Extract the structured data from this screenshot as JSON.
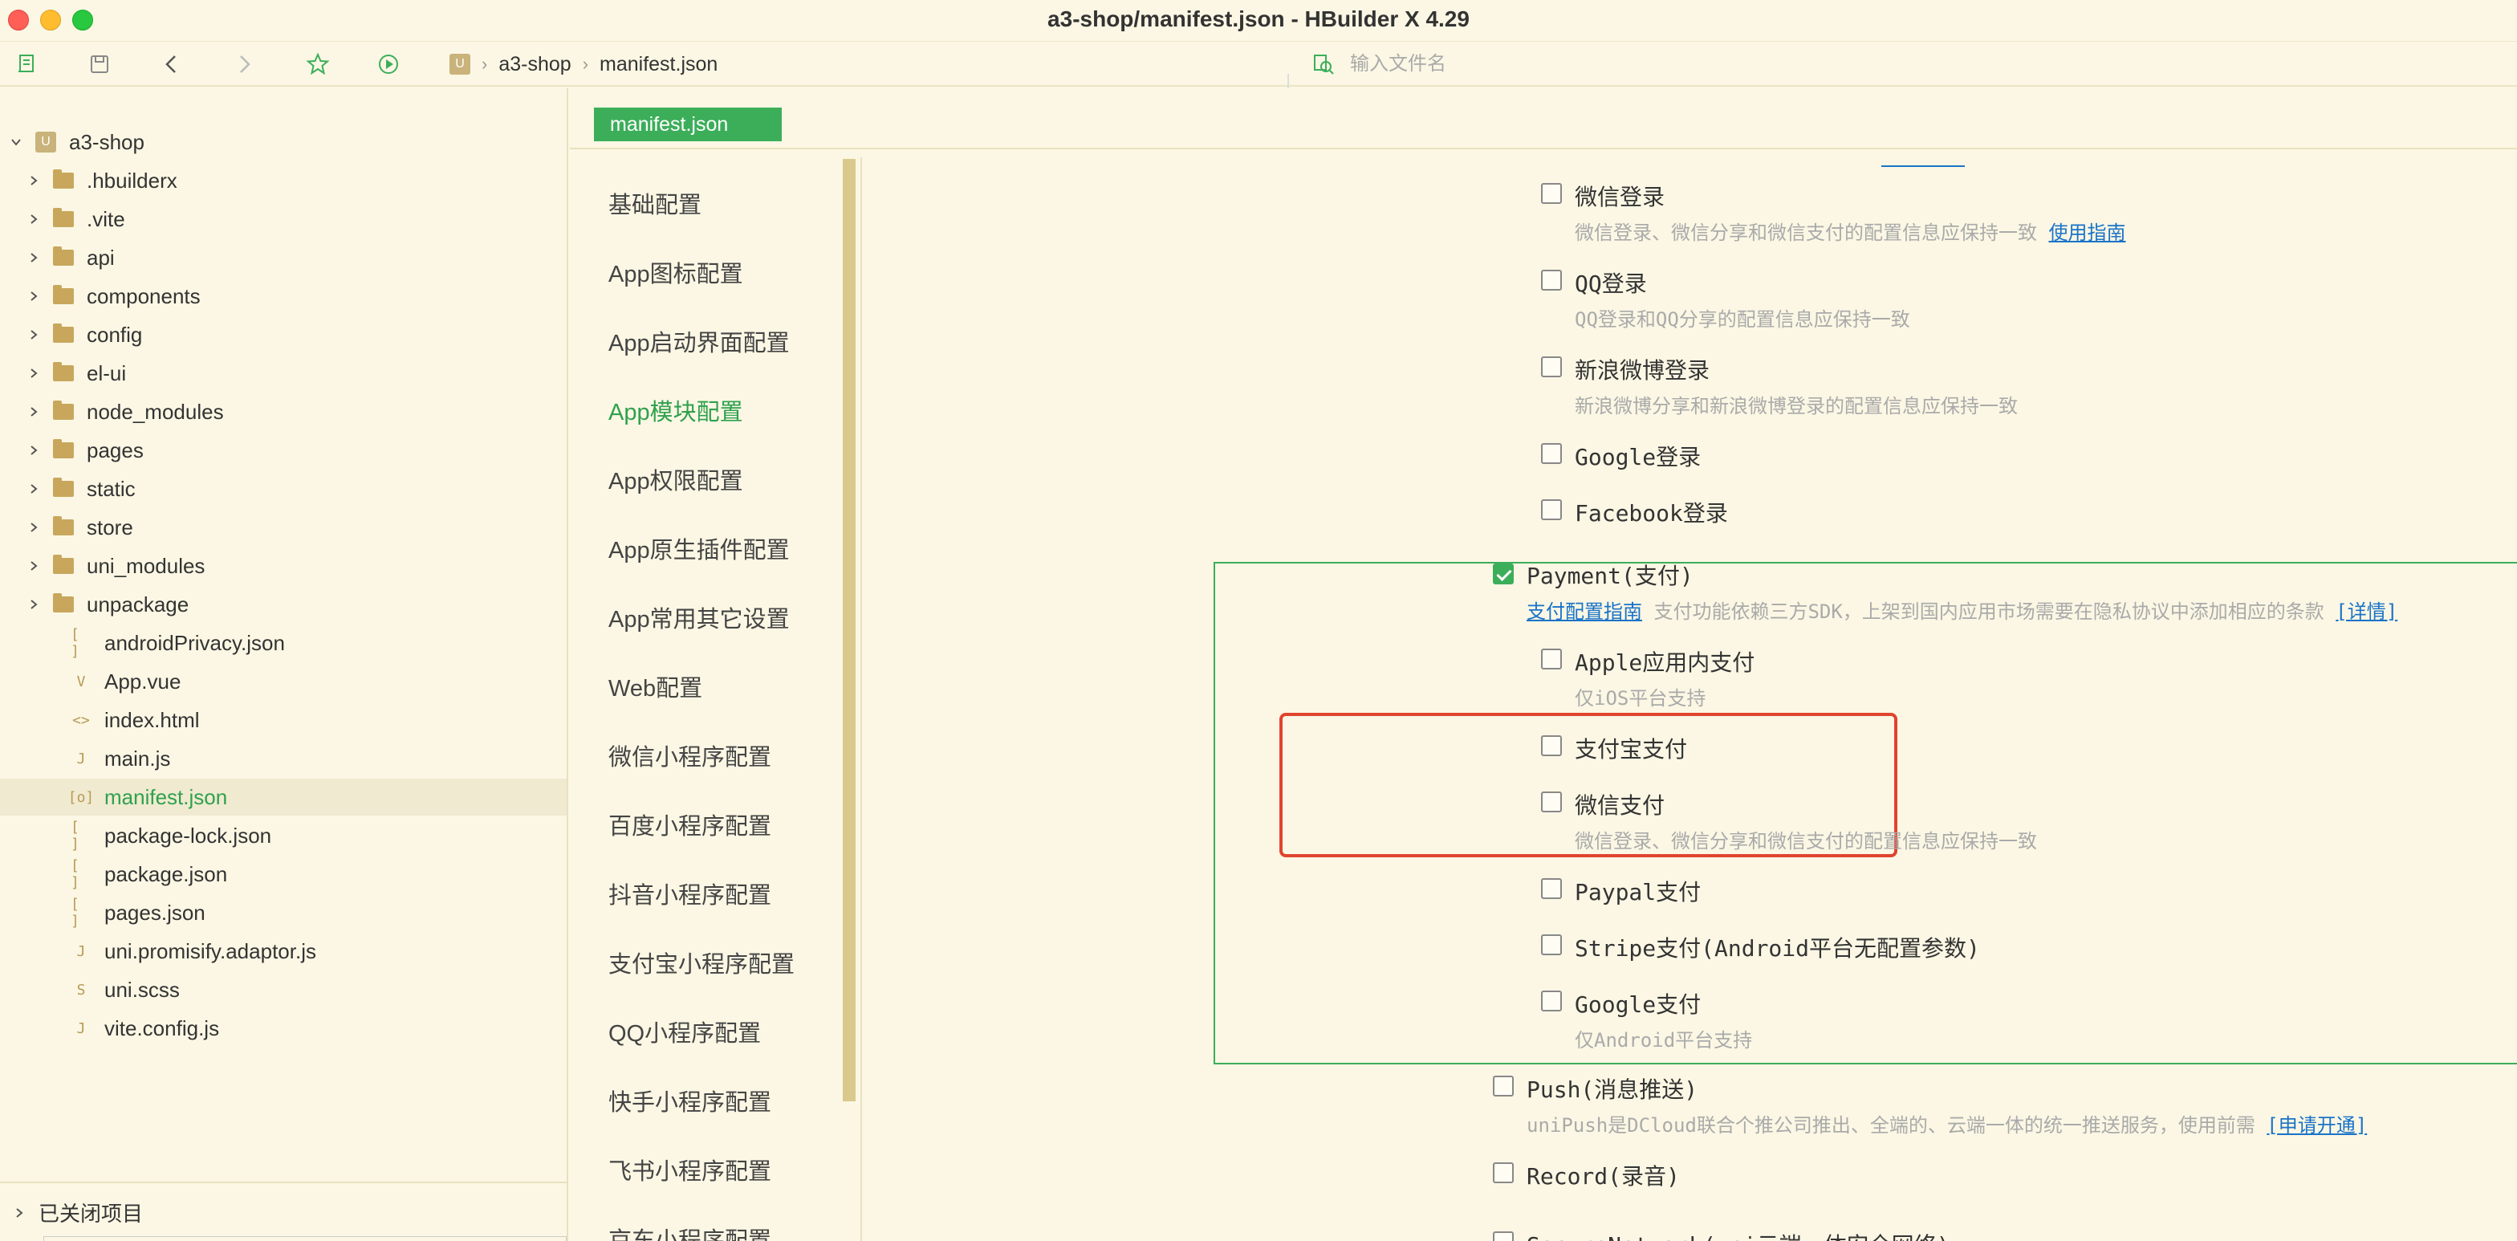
{
  "window": {
    "title": "a3-shop/manifest.json - HBuilder X 4.29"
  },
  "toolbar": {
    "breadcrumb": [
      "a3-shop",
      "manifest.json"
    ],
    "search_placeholder": "输入文件名",
    "icons": [
      "new-file-icon",
      "save-icon",
      "back-icon",
      "forward-icon",
      "star-icon",
      "run-icon"
    ]
  },
  "sidebar": {
    "project": "a3-shop",
    "items": [
      {
        "label": ".hbuilderx",
        "type": "folder"
      },
      {
        "label": ".vite",
        "type": "folder"
      },
      {
        "label": "api",
        "type": "folder"
      },
      {
        "label": "components",
        "type": "folder"
      },
      {
        "label": "config",
        "type": "folder"
      },
      {
        "label": "el-ui",
        "type": "folder"
      },
      {
        "label": "node_modules",
        "type": "folder"
      },
      {
        "label": "pages",
        "type": "folder"
      },
      {
        "label": "static",
        "type": "folder"
      },
      {
        "label": "store",
        "type": "folder"
      },
      {
        "label": "uni_modules",
        "type": "folder"
      },
      {
        "label": "unpackage",
        "type": "folder"
      },
      {
        "label": "androidPrivacy.json",
        "type": "json"
      },
      {
        "label": "App.vue",
        "type": "vue"
      },
      {
        "label": "index.html",
        "type": "html"
      },
      {
        "label": "main.js",
        "type": "js"
      },
      {
        "label": "manifest.json",
        "type": "manifest",
        "selected": true
      },
      {
        "label": "package-lock.json",
        "type": "json"
      },
      {
        "label": "package.json",
        "type": "json"
      },
      {
        "label": "pages.json",
        "type": "json"
      },
      {
        "label": "uni.promisify.adaptor.js",
        "type": "js"
      },
      {
        "label": "uni.scss",
        "type": "scss"
      },
      {
        "label": "vite.config.js",
        "type": "js"
      }
    ],
    "footer_label": "已关闭项目"
  },
  "editor": {
    "tab_label": "manifest.json",
    "nav": [
      "基础配置",
      "App图标配置",
      "App启动界面配置",
      "App模块配置",
      "App权限配置",
      "App原生插件配置",
      "App常用其它设置",
      "Web配置",
      "微信小程序配置",
      "百度小程序配置",
      "抖音小程序配置",
      "支付宝小程序配置",
      "QQ小程序配置",
      "快手小程序配置",
      "飞书小程序配置",
      "京东小程序配置"
    ],
    "nav_active_index": 3,
    "options": {
      "wechat_login": {
        "label": "微信登录",
        "desc": "微信登录、微信分享和微信支付的配置信息应保持一致",
        "link": "使用指南",
        "checked": false
      },
      "qq_login": {
        "label": "QQ登录",
        "desc": "QQ登录和QQ分享的配置信息应保持一致",
        "checked": false
      },
      "weibo_login": {
        "label": "新浪微博登录",
        "desc": "新浪微博分享和新浪微博登录的配置信息应保持一致",
        "checked": false
      },
      "google_login": {
        "label": "Google登录",
        "checked": false
      },
      "facebook_login": {
        "label": "Facebook登录",
        "checked": false
      },
      "payment": {
        "label": "Payment(支付)",
        "guide_link": "支付配置指南",
        "desc": "支付功能依赖三方SDK，上架到国内应用市场需要在隐私协议中添加相应的条款",
        "detail_link": "[详情]",
        "checked": true
      },
      "apple_pay": {
        "label": "Apple应用内支付",
        "desc": "仅iOS平台支持",
        "checked": false
      },
      "alipay": {
        "label": "支付宝支付",
        "checked": false
      },
      "wechat_pay": {
        "label": "微信支付",
        "desc": "微信登录、微信分享和微信支付的配置信息应保持一致",
        "checked": false
      },
      "paypal": {
        "label": "Paypal支付",
        "checked": false
      },
      "stripe": {
        "label": "Stripe支付(Android平台无配置参数)",
        "checked": false
      },
      "google_pay": {
        "label": "Google支付",
        "desc": "仅Android平台支持",
        "checked": false
      },
      "push": {
        "label": "Push(消息推送)",
        "desc": "uniPush是DCloud联合个推公司推出、全端的、云端一体的统一推送服务，使用前需",
        "link": "[申请开通]",
        "checked": false
      },
      "record": {
        "label": "Record(录音)",
        "checked": false
      },
      "secure_network": {
        "label": "SecureNetwork(uni云端一体安全网络)",
        "checked": false
      }
    }
  },
  "colors": {
    "accent_green": "#3cae5a",
    "highlight_red": "#e0442f",
    "link_blue": "#1a73c8",
    "background": "#fbf7e4"
  }
}
